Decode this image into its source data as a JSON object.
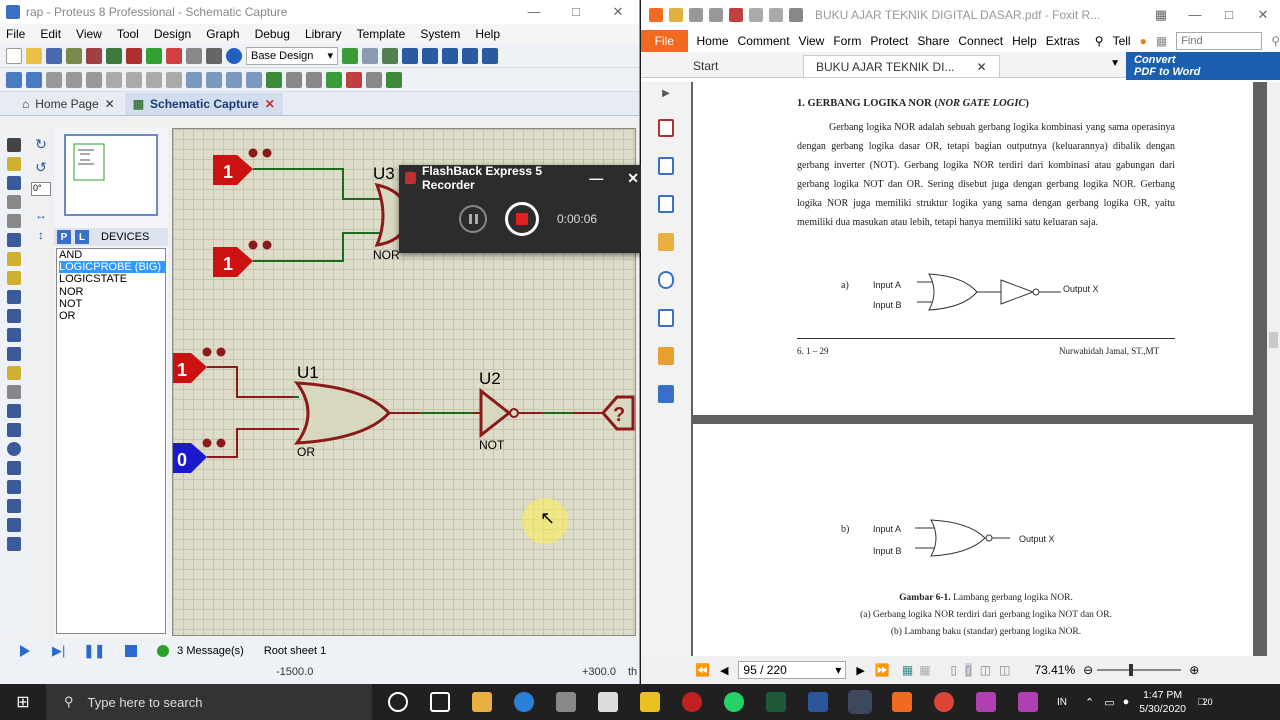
{
  "proteus": {
    "title": "rap - Proteus 8 Professional - Schematic Capture",
    "menu": [
      "File",
      "Edit",
      "View",
      "Tool",
      "Design",
      "Graph",
      "Debug",
      "Library",
      "Template",
      "System",
      "Help"
    ],
    "design_select": "Base Design",
    "tabs": [
      {
        "label": "Home Page"
      },
      {
        "label": "Schematic Capture"
      }
    ],
    "angle_field": "0°",
    "devices_title": "DEVICES",
    "picker_p": "P",
    "picker_l": "L",
    "devices": [
      "AND",
      "LOGICPROBE (BIG)",
      "LOGICSTATE",
      "NOR",
      "NOT",
      "OR"
    ],
    "selected_device": "LOGICPROBE (BIG)",
    "messages": "3 Message(s)",
    "sheet": "Root sheet 1",
    "coord_x": "-1500.0",
    "coord_y": "+300.0",
    "coord_unit": "th",
    "schematic": {
      "u3_label": "U3",
      "u3_type": "NOR",
      "u1_label": "U1",
      "u1_type": "OR",
      "u2_label": "U2",
      "u2_type": "NOT",
      "state_1": "1",
      "state_2": "1",
      "state_3": "1",
      "state_4": "0",
      "probe": "?"
    }
  },
  "recorder": {
    "title": "FlashBack Express 5 Recorder",
    "time": "0:00:06"
  },
  "foxit": {
    "title": "BUKU AJAR TEKNIK DIGITAL DASAR.pdf - Foxit R...",
    "file_btn": "File",
    "ribbon": [
      "Home",
      "Comment",
      "View",
      "Form",
      "Protect",
      "Share",
      "Connect",
      "Help",
      "Extras"
    ],
    "tell": "Tell",
    "find_placeholder": "Find",
    "tabs": [
      {
        "label": "Start"
      },
      {
        "label": "BUKU AJAR TEKNIK DI..."
      }
    ],
    "convert_line1": "Convert",
    "convert_line2": "PDF to Word",
    "page_nav": "95 / 220",
    "zoom": "73.41%"
  },
  "document": {
    "heading_num": "1.",
    "heading": "GERBANG LOGIKA NOR (",
    "heading_italic": "NOR GATE LOGIC",
    "heading_end": ")",
    "paragraph": "Gerbang logika NOR adalah sebuah gerbang logika kombinasi yang sama operasinya dengan gerbang logika dasar OR, tetapi bagian outputnya (keluarannya) dibalik dengan gerbang inverter (NOT). Gerbang logika NOR terdiri dari kombinasi atau gabungan dari gerbang logika NOT dan OR. Sering disebut juga dengan gerbang logika NOR. Gerbang logika NOR juga memiliki struktur logika yang sama dengan gerbang logika OR, yaitu memiliki dua masukan atau lebih, tetapi hanya memiliki satu keluaran saja.",
    "fig_a": "a)",
    "fig_b": "b)",
    "input_a": "Input A",
    "input_b": "Input B",
    "output_x": "Output X",
    "footer_left": "6. 1 – 29",
    "footer_right": "Nurwahidah Jamal, ST.,MT",
    "caption_bold": "Gambar 6-1.",
    "caption_title": " Lambang gerbang logika NOR.",
    "caption_a": "(a) Gerbang logika NOR terdiri dari gerbang logika NOT dan OR.",
    "caption_b": "(b) Lambang baku (standar) gerbang logika NOR."
  },
  "taskbar": {
    "search_placeholder": "Type here to search",
    "lang": "IN",
    "time": "1:47 PM",
    "date": "5/30/2020",
    "notif_count": "20"
  },
  "colors": {
    "state_red": "#cc1111",
    "state_blue": "#1a1acc",
    "gate_outline": "#8b1a1a",
    "gate_fill": "#d8d8c0",
    "wire_green": "#1f6a1f",
    "foxit_orange": "#f26a21"
  }
}
